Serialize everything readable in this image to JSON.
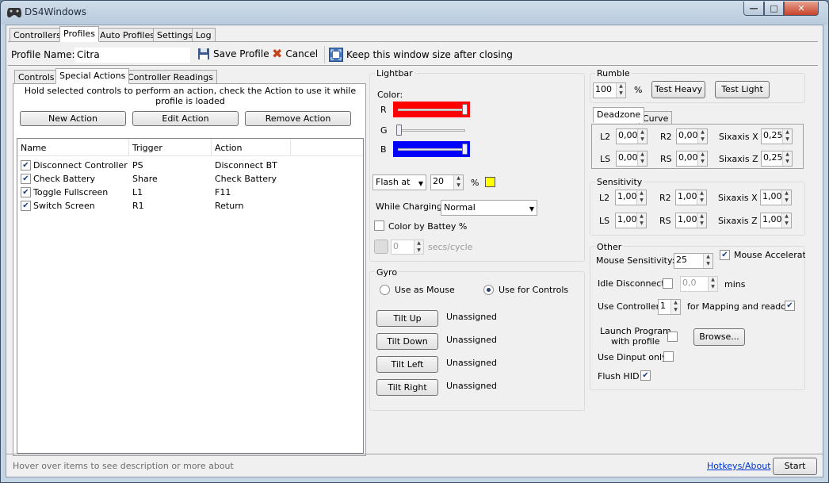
{
  "window": {
    "title": "DS4Windows",
    "min": "—",
    "max": "□",
    "close": "✕"
  },
  "main_tabs": [
    "Controllers",
    "Profiles",
    "Auto Profiles",
    "Settings",
    "Log"
  ],
  "profile": {
    "name_label": "Profile Name:",
    "name_value": "Citra",
    "save": "Save Profile",
    "cancel": "Cancel",
    "keep": "Keep this window size after closing"
  },
  "sub_tabs": [
    "Controls",
    "Special Actions",
    "Controller Readings"
  ],
  "special_actions": {
    "hint": "Hold selected controls to perform an action, check the Action to use it while profile is loaded",
    "new": "New Action",
    "edit": "Edit Action",
    "remove": "Remove Action",
    "columns": [
      "Name",
      "Trigger",
      "Action"
    ],
    "rows": [
      {
        "checked": true,
        "name": "Disconnect Controller",
        "trigger": "PS",
        "action": "Disconnect BT"
      },
      {
        "checked": true,
        "name": "Check Battery",
        "trigger": "Share",
        "action": "Check Battery"
      },
      {
        "checked": true,
        "name": "Toggle Fullscreen",
        "trigger": "L1",
        "action": "F11"
      },
      {
        "checked": true,
        "name": "Switch Screen",
        "trigger": "R1",
        "action": "Return"
      }
    ]
  },
  "lightbar": {
    "title": "Lightbar",
    "color_label": "Color:",
    "r": "R",
    "g": "G",
    "b": "B",
    "r_value": 1.0,
    "g_value": 0.0,
    "b_value": 1.0,
    "r_color": "#ff0000",
    "b_color": "#0000ff",
    "flash_mode": "Flash at",
    "flash_value": "20",
    "percent": "%",
    "flash_color": "#ffff00",
    "charging_label": "While Charging:",
    "charging_value": "Normal",
    "color_battery": "Color by Battey %",
    "cycle_value": "0",
    "cycle_unit": "secs/cycle"
  },
  "gyro": {
    "title": "Gyro",
    "use_mouse": "Use as Mouse",
    "use_controls": "Use for Controls",
    "tilt_up": "Tilt Up",
    "tilt_down": "Tilt Down",
    "tilt_left": "Tilt Left",
    "tilt_right": "Tilt Right",
    "unassigned": "Unassigned"
  },
  "rumble": {
    "title": "Rumble",
    "value": "100",
    "percent": "%",
    "heavy": "Test Heavy",
    "light": "Test Light"
  },
  "deadzone": {
    "tab_deadzone": "Deadzone",
    "tab_curve": "Curve",
    "l2": "L2",
    "r2": "R2",
    "ls": "LS",
    "rs": "RS",
    "sx": "Sixaxis X",
    "sz": "Sixaxis Z",
    "l2v": "0,00",
    "r2v": "0,00",
    "lsv": "0,00",
    "rsv": "0,00",
    "sxv": "0,25",
    "szv": "0,25"
  },
  "sensitivity": {
    "title": "Sensitivity",
    "l2": "L2",
    "r2": "R2",
    "ls": "LS",
    "rs": "RS",
    "sx": "Sixaxis X",
    "sz": "Sixaxis Z",
    "l2v": "1,00",
    "r2v": "1,00",
    "lsv": "1,00",
    "rsv": "1,00",
    "sxv": "1,00",
    "szv": "1,00"
  },
  "other": {
    "title": "Other",
    "mouse_sens": "Mouse Sensitivity:",
    "mouse_sens_value": "25",
    "mouse_accel": "Mouse Acceleration",
    "idle": "Idle Disconnect",
    "idle_value": "0,0",
    "mins": "mins",
    "use_ctrl": "Use Controller",
    "use_ctrl_value": "1",
    "for_mapping": "for Mapping and readout",
    "launch1": "Launch Program",
    "launch2": "with profile",
    "browse": "Browse...",
    "dinput": "Use Dinput only",
    "flush": "Flush HID"
  },
  "status": {
    "hover": "Hover over items to see description or more about",
    "hotkeys": "Hotkeys/About",
    "start": "Start"
  }
}
